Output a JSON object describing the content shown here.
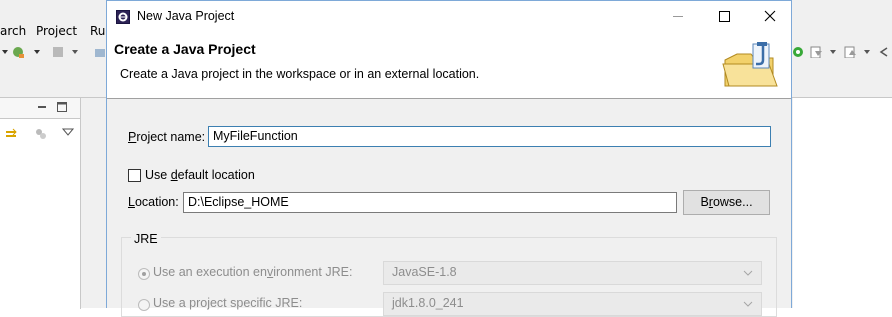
{
  "eclipse": {
    "menu": [
      "arch",
      "Project",
      "Ru"
    ]
  },
  "dialog": {
    "title": "New Java Project",
    "header_title": "Create a Java Project",
    "header_desc": "Create a Java project in the workspace or in an external location.",
    "project_name": {
      "label_pre": "",
      "label_u": "P",
      "label_post": "roject name:",
      "value": "MyFileFunction"
    },
    "use_default": {
      "label_pre": "Use ",
      "label_u": "d",
      "label_post": "efault location",
      "checked": false
    },
    "location": {
      "label_pre": "",
      "label_u": "L",
      "label_post": "ocation:",
      "value": "D:\\Eclipse_HOME"
    },
    "browse": {
      "pre": "B",
      "u": "r",
      "post": "owse..."
    },
    "jre": {
      "group_label": "JRE",
      "option1": {
        "pre": "Use an execution en",
        "u": "v",
        "post": "ironment JRE:",
        "selected": true
      },
      "option1_value": "JavaSE-1.8",
      "option2": {
        "pre": "Use a project specific JRE:",
        "selected": false
      },
      "option2_value": "jdk1.8.0_241"
    }
  },
  "colors": {
    "dialog_border": "#7ea9d8",
    "focus_border": "#3c7fb1",
    "disabled_text": "#8d8d8d"
  }
}
